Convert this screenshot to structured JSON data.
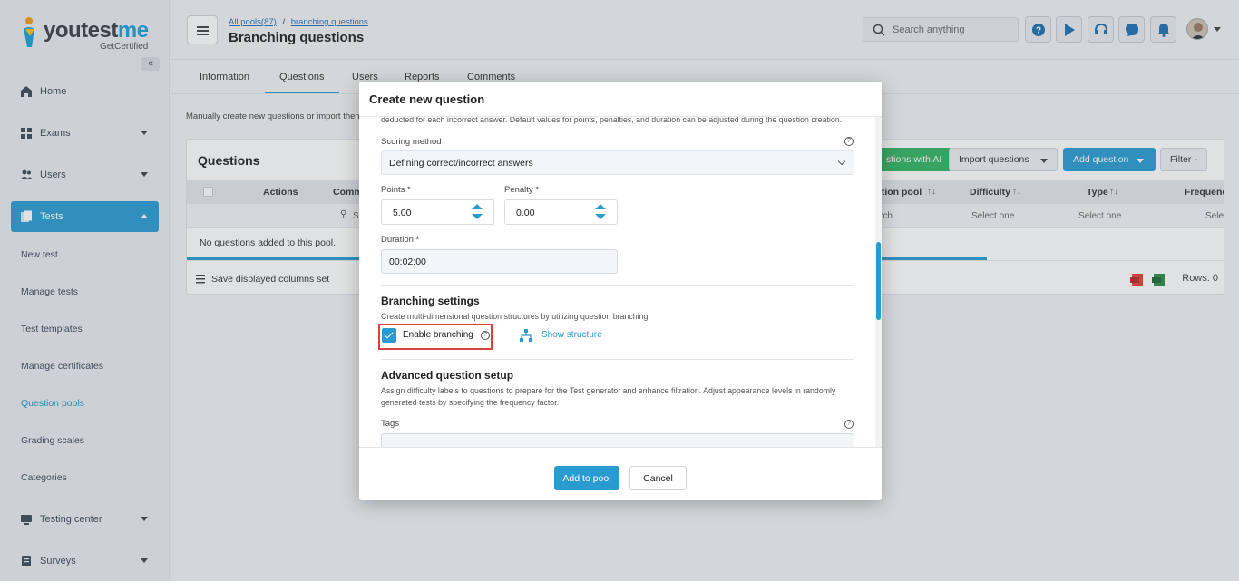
{
  "brand": {
    "name_a": "youtest",
    "name_b": "me",
    "tagline": "GetCertified"
  },
  "sidebar": {
    "collapse_glyph": "«",
    "items": [
      {
        "label": "Home",
        "icon": "home-icon"
      },
      {
        "label": "Exams",
        "icon": "exams-icon"
      },
      {
        "label": "Users",
        "icon": "users-icon"
      },
      {
        "label": "Tests",
        "icon": "tests-icon"
      },
      {
        "label": "Testing center",
        "icon": "testing-center-icon"
      },
      {
        "label": "Surveys",
        "icon": "surveys-icon"
      }
    ],
    "sub_items": [
      "New test",
      "Manage tests",
      "Test templates",
      "Manage certificates",
      "Question pools",
      "Grading scales",
      "Categories"
    ]
  },
  "header": {
    "breadcrumb_root": "All pools(87)",
    "breadcrumb_sep": "/",
    "breadcrumb_current": "branching questions",
    "title": "Branching questions",
    "search_placeholder": "Search anything"
  },
  "tabs": [
    "Information",
    "Questions",
    "Users",
    "Reports",
    "Comments"
  ],
  "info_text": "Manually create new questions or import them",
  "questions_panel": {
    "title": "Questions",
    "ai_button": "stions with AI",
    "import_button": "Import questions",
    "add_button": "Add question",
    "filter_button": "Filter",
    "columns": {
      "actions": "Actions",
      "comm": "Comm",
      "pool": "stion pool",
      "difficulty": "Difficulty",
      "type": "Type",
      "frequency": "Frequenc"
    },
    "filter_search": "S",
    "filter_search2": "rch",
    "select_one": "Select one",
    "select_trunc": "Selec",
    "empty": "No questions added to this pool.",
    "save_columns": "Save displayed columns set",
    "rows": "Rows: 0"
  },
  "modal": {
    "title": "Create new question",
    "top_desc": "deducted for each incorrect answer. Default values for points, penalties, and duration can be adjusted during the question creation.",
    "scoring_label": "Scoring method",
    "scoring_value": "Defining correct/incorrect answers",
    "points_label": "Points *",
    "points_value": "5.00",
    "penalty_label": "Penalty *",
    "penalty_value": "0.00",
    "duration_label": "Duration *",
    "duration_value": "00:02:00",
    "branching_title": "Branching settings",
    "branching_desc": "Create multi-dimensional question structures by utilizing question branching.",
    "enable_branching": "Enable branching",
    "show_structure": "Show structure",
    "advanced_title": "Advanced question setup",
    "advanced_desc_1": "Assign difficulty labels to questions to prepare for the Test generator and enhance filtration. Adjust appearance levels in randomly",
    "advanced_desc_2": "generated tests by specifying the frequency factor.",
    "tags_label": "Tags",
    "add_to_pool": "Add to pool",
    "cancel": "Cancel"
  },
  "colors": {
    "accent": "#2a9bd1",
    "highlight": "#d9413a"
  }
}
